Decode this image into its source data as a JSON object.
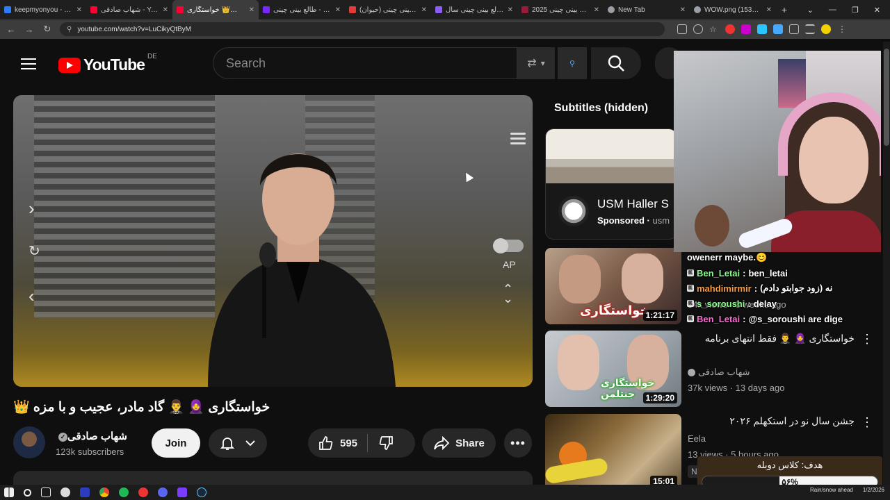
{
  "browser": {
    "tabs": [
      {
        "label": "keepmyonyou - 7TV",
        "color": "#2d7cff",
        "active": false
      },
      {
        "label": "شهاب صادقی - YouTube",
        "color": "#ff0033",
        "active": false
      },
      {
        "label": "خواستگاری 👑🧕🤵‍♂️",
        "color": "#ff0033",
        "active": true
      },
      {
        "label": "طالع بینی چینی - ults",
        "color": "#7a26ff",
        "active": false
      },
      {
        "label": "طالع بینی چینی (حیوان)",
        "color": "#e23b3b",
        "active": false
      },
      {
        "label": "طالع بینی چینی سال",
        "color": "#8b5cf6",
        "active": false
      },
      {
        "label": "طالع بینی چینی 2025",
        "color": "#9a1a3a",
        "active": false
      },
      {
        "label": "New Tab",
        "color": "#9aa0a6",
        "active": false
      },
      {
        "label": "WOW.png (1536×10",
        "color": "#9aa0a6",
        "active": false
      }
    ],
    "url": "youtube.com/watch?v=LuCikyQtByM"
  },
  "header": {
    "logo_text": "YouTube",
    "country": "DE",
    "search_placeholder": "Search"
  },
  "video": {
    "title": "خواستگاری 🧕 🤵‍♂️ گاد مادر، عجیب و با مزه 👑",
    "ap_label": "AP",
    "channel_name": "شهاب صادقی",
    "subscribers": "123k subscribers",
    "join_label": "Join",
    "likes": "595",
    "share_label": "Share"
  },
  "sidebar": {
    "subtitles_label": "Subtitles (hidden)",
    "ad": {
      "title": "USM Haller S",
      "sponsored": "Sponsored",
      "advertiser": "usm"
    },
    "videos": [
      {
        "duration": "1:21:17",
        "thumb_text": "خواستگاری",
        "views": "54k views · 3 weeks ago"
      },
      {
        "duration": "1:29:20",
        "thumb_text": "خواستگاری جنتلمن",
        "title": "خواستگاری 🧕 🤵‍♂️ فقط انتهای برنامه",
        "channel": "شهاب صادقی",
        "views": "37k views · 13 days ago"
      },
      {
        "duration": "15:01",
        "title": "جشن سال نو در استکهلم ۲۰۲۶",
        "channel": "Eela",
        "views": "13 views · 5 hours ago",
        "badge": "New"
      }
    ]
  },
  "chat": [
    {
      "user": "",
      "text": "owenerr maybe.😊"
    },
    {
      "user": "Ben_Letai",
      "text": "ben_letai"
    },
    {
      "user": "mahdimirmir",
      "text": "نه (زود جوابتو دادم)"
    },
    {
      "user": "s_soroushi",
      "text": "delay"
    },
    {
      "user": "Ben_Letai",
      "text": "@s_soroushi are dige"
    }
  ],
  "goal": {
    "title": "هدف: کلاس دوبله",
    "percent": 0.56,
    "percent_label": "۵۶%"
  },
  "taskbar": {
    "weather": "Rain/snow ahead",
    "date": "1/2/2026"
  },
  "colors": {
    "brand": "#ff0000",
    "background": "#0f0f0f"
  }
}
